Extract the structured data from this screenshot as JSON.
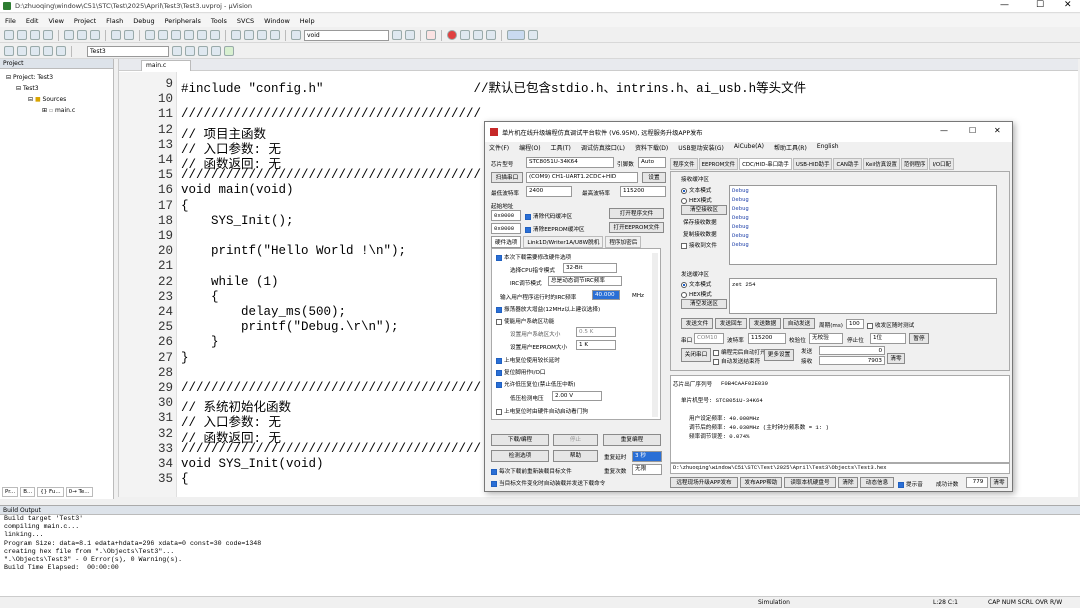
{
  "window": {
    "title": "D:\\zhuoqing\\window\\C51\\STC\\Test\\2025\\April\\Test3\\Test3.uvproj - µVision"
  },
  "menu": [
    "File",
    "Edit",
    "View",
    "Project",
    "Flash",
    "Debug",
    "Peripherals",
    "Tools",
    "SVCS",
    "Window",
    "Help"
  ],
  "toolbar": {
    "func_combo": "void",
    "target_combo": "Test3"
  },
  "project": {
    "header": "Project",
    "root": "Project: Test3",
    "target": "Test3",
    "group": "Sources",
    "file": "main.c",
    "tabs": [
      "Pr...",
      "B...",
      "{} Fu...",
      "0→ Te..."
    ]
  },
  "editor": {
    "tab": "main.c",
    "lines": [
      {
        "n": "9",
        "t": "#include \"config.h\"                    //默认已包含stdio.h、intrins.h、ai_usb.h等头文件"
      },
      {
        "n": "10",
        "t": ""
      },
      {
        "n": "11",
        "t": "////////////////////////////////////////"
      },
      {
        "n": "12",
        "t": "// 项目主函数"
      },
      {
        "n": "13",
        "t": "// 入口参数: 无"
      },
      {
        "n": "14",
        "t": "// 函数返回: 无"
      },
      {
        "n": "15",
        "t": "////////////////////////////////////////"
      },
      {
        "n": "16",
        "t": "void main(void)"
      },
      {
        "n": "17",
        "t": "{"
      },
      {
        "n": "18",
        "t": "    SYS_Init();"
      },
      {
        "n": "19",
        "t": ""
      },
      {
        "n": "20",
        "t": "    printf(\"Hello World !\\n\");"
      },
      {
        "n": "21",
        "t": ""
      },
      {
        "n": "22",
        "t": "    while (1)"
      },
      {
        "n": "23",
        "t": "    {"
      },
      {
        "n": "24",
        "t": "        delay_ms(500);"
      },
      {
        "n": "25",
        "t": "        printf(\"Debug.\\r\\n\");"
      },
      {
        "n": "26",
        "t": "    }"
      },
      {
        "n": "27",
        "t": "}"
      },
      {
        "n": "28",
        "t": ""
      },
      {
        "n": "29",
        "t": "////////////////////////////////////////"
      },
      {
        "n": "30",
        "t": "// 系统初始化函数"
      },
      {
        "n": "31",
        "t": "// 入口参数: 无"
      },
      {
        "n": "32",
        "t": "// 函数返回: 无"
      },
      {
        "n": "33",
        "t": "////////////////////////////////////////"
      },
      {
        "n": "34",
        "t": "void SYS_Init(void)"
      },
      {
        "n": "35",
        "t": "{"
      }
    ]
  },
  "build": {
    "header": "Build Output",
    "lines": [
      "Build target 'Test3'",
      "compiling main.c...",
      "linking...",
      "Program Size: data=8.1 edata+hdata=296 xdata=0 const=30 code=1348",
      "creating hex file from \".\\Objects\\Test3\"...",
      "\".\\Objects\\Test3\" - 0 Error(s), 0 Warning(s).",
      "Build Time Elapsed:  00:00:00"
    ]
  },
  "status": {
    "mode": "Simulation",
    "pos": "L:28 C:1",
    "flags": "CAP NUM SCRL OVR R/W"
  },
  "isp": {
    "title": "单片机在线升级编程仿真调试平台软件 (V6.95M), 远程服务升级APP发布",
    "menu": [
      "文件(F)",
      "编程(O)",
      "工具(T)",
      "调试仿真接口(L)",
      "资料下载(D)",
      "USB驱动安装(G)",
      "AiCube(A)",
      "帮助工具(R)",
      "English"
    ],
    "chip_label": "芯片型号",
    "chip": "STC8051U-34K64",
    "pins_label": "引脚数",
    "pins": "Auto",
    "scan_port": "扫描串口",
    "port": "(COM9) CH1-UART1.2CDC+HID",
    "settings": "设置",
    "min_baud_label": "最低波特率",
    "min_baud": "2400",
    "max_baud_label": "最高波特率",
    "max_baud": "115200",
    "start_addr": "起始地址",
    "addr1": "0x0000",
    "clear_code": "清除代码缓冲区",
    "open_prog": "打开程序文件",
    "addr2": "0x0000",
    "clear_eeprom": "清除EEPROM缓冲区",
    "open_eeprom": "打开EEPROM文件",
    "hwtabs": [
      "硬件选项",
      "Link1D/Writer1A/U8W脱机",
      "程序加密后"
    ],
    "opts": [
      "本次下载需要修改硬件选项",
      "选择CPU指令模式",
      "32-Bit",
      "IRC调节模式",
      "总是动态调节IRC频率",
      "输入用户程序运行时的IRC频率",
      "40.000",
      "MHz",
      "振荡器放大增益(12MHz以上建议选择)",
      "使能用户系统区功能",
      "设置用户系统区大小",
      "0.5 K",
      "设置用户EEPROM大小",
      "1  K",
      "上电复位使用较长延时",
      "复位脚用作I/O口",
      "允许低压复位(禁止低压中断)",
      "低压检测电压",
      "2.00 V",
      "上电复位时由硬件自动启动看门狗"
    ],
    "download": "下载/编程",
    "stop": "停止",
    "reprogram": "重复编程",
    "detect": "检测选项",
    "help": "帮助",
    "redelay_label": "重复延时",
    "redelay": "3 秒",
    "recount_label": "重复次数",
    "recount": "无限",
    "reload1": "每次下载前重新装载目标文件",
    "reload2": "当目标文件变化时自动装载并发送下载命令",
    "rtabs": [
      "程序文件",
      "EEPROM文件",
      "CDC/HID-串口助手",
      "USB-HID助手",
      "CAN助手",
      "Keil仿真设置",
      "范例程序",
      "I/O口配"
    ],
    "recv_label": "接收缓冲区",
    "text_mode": "文本模式",
    "hex_mode": "HEX模式",
    "clear_recv": "清空接收区",
    "save_recv": "保存接收数据",
    "copy_recv": "复制接收数据",
    "recv_file": "接收到文件",
    "recv_data": [
      "Debug",
      "Debug",
      "Debug",
      "Debug",
      "Debug",
      "Debug",
      "Debug"
    ],
    "send_label": "发送缓冲区",
    "clear_send": "清空发送区",
    "send_data": "zet 254",
    "send_btns": [
      "发送文件",
      "发送回车",
      "发送数据",
      "自动发送"
    ],
    "period_label": "周期(ms)",
    "period": "100",
    "noclear": "收发区随时测试",
    "serial_label": "串口",
    "serial": "COM10",
    "baud_label": "波特率",
    "baud": "115200",
    "parity_label": "校验位",
    "parity": "无校验",
    "stop_label": "停止位",
    "stopbits": "1位",
    "ask": "暂停",
    "close_port": "关闭串口",
    "auto_open": "编程完后自动打开",
    "auto_close": "自动发送结束符",
    "more": "更多设置",
    "sent_label": "发送",
    "sent": "0",
    "recv_count_label": "接收",
    "recv_count": "7903",
    "clear_count": "清零",
    "chip_id_label": "芯片出厂序列号",
    "chip_id": "F0B4CAAF02E039",
    "info": [
      "单片机型号: STC8051U-34K64",
      "",
      "用户设定频率: 40.000MHz",
      "调节后的频率: 40.030MHz (主时钟分频系数 = 1: )",
      "频率调节误差: 0.074%"
    ],
    "hexpath": "D:\\zhuoqing\\window\\C51\\STC\\Test\\2025\\April\\Test3\\Objects\\Test3.hex",
    "bottom": [
      "远程现场升级APP发布",
      "发布APP帮助",
      "读取本机硬盘号",
      "清除",
      "动态信息",
      "提示音",
      "成功计数",
      "779",
      "清零"
    ]
  }
}
